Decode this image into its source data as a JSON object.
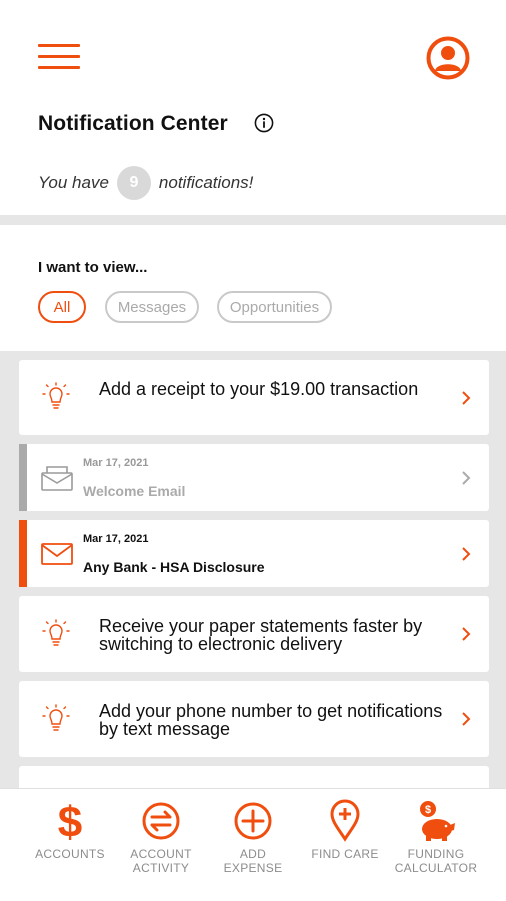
{
  "header": {
    "title": "Notification Center",
    "notif_prefix": "You have",
    "notif_count": "9",
    "notif_suffix": "notifications!"
  },
  "filters": {
    "label": "I want to view...",
    "chips": [
      "All",
      "Messages",
      "Opportunities"
    ],
    "selected": "All"
  },
  "notifications": [
    {
      "type": "tip",
      "text": "Add a receipt to your $19.00 transaction"
    },
    {
      "type": "message",
      "read": true,
      "date": "Mar 17, 2021",
      "subject": "Welcome Email"
    },
    {
      "type": "message",
      "read": false,
      "date": "Mar 17, 2021",
      "subject": "Any Bank - HSA Disclosure"
    },
    {
      "type": "tip",
      "text": "Receive your paper statements faster by switching to electronic delivery"
    },
    {
      "type": "tip",
      "text": "Add your phone number to get notifications by text message"
    }
  ],
  "bottom_nav": [
    {
      "label_line1": "ACCOUNTS",
      "label_line2": "",
      "icon": "dollar-icon"
    },
    {
      "label_line1": "ACCOUNT",
      "label_line2": "ACTIVITY",
      "icon": "transfer-arrows-icon"
    },
    {
      "label_line1": "ADD",
      "label_line2": "EXPENSE",
      "icon": "plus-circle-icon"
    },
    {
      "label_line1": "FIND CARE",
      "label_line2": "",
      "icon": "location-pin-plus-icon"
    },
    {
      "label_line1": "FUNDING",
      "label_line2": "CALCULATOR",
      "icon": "piggy-bank-icon"
    }
  ],
  "colors": {
    "accent": "#f04e0f",
    "muted": "#aaaaaa",
    "background": "#e6e6e6",
    "read_bar": "#aaaaaa"
  }
}
